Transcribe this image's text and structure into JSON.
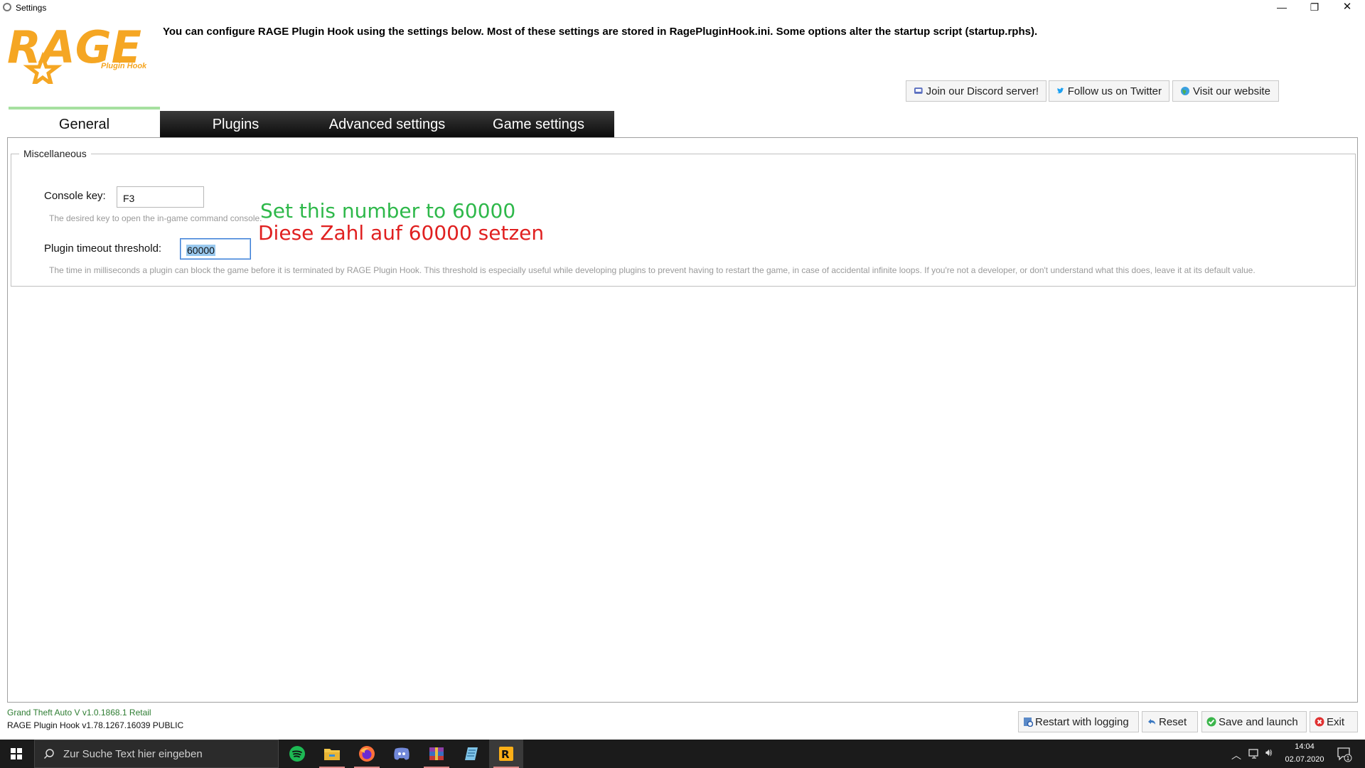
{
  "window": {
    "title": "Settings",
    "controls": {
      "minimize": "—",
      "maximize": "❐",
      "close": "✕"
    }
  },
  "header": {
    "description": "You can configure RAGE Plugin Hook using the settings below. Most of these settings are stored in RagePluginHook.ini. Some options alter the startup script (startup.rphs).",
    "logo": {
      "main": "RAGE",
      "sub": "Plugin Hook"
    },
    "links": {
      "discord": "Join our Discord server!",
      "twitter": "Follow us on Twitter",
      "website": "Visit our website"
    }
  },
  "tabs": [
    {
      "label": "General",
      "active": true
    },
    {
      "label": "Plugins",
      "active": false
    },
    {
      "label": "Advanced settings",
      "active": false
    },
    {
      "label": "Game settings",
      "active": false
    }
  ],
  "misc": {
    "legend": "Miscellaneous",
    "console_key": {
      "label": "Console key:",
      "value": "F3",
      "hint": "The desired key to open the in-game command console."
    },
    "timeout": {
      "label": "Plugin timeout threshold:",
      "value": "60000",
      "hint": "The time in milliseconds a plugin can block the game before it is terminated by RAGE Plugin Hook. This threshold is especially useful while developing plugins to prevent having to restart the game, in case of accidental infinite loops. If you're not a developer, or don't understand what this does, leave it at its default value."
    }
  },
  "annotations": {
    "english": "Set this number to 60000",
    "german": "Diese Zahl auf 60000 setzen"
  },
  "footer": {
    "game_version": "Grand Theft Auto V v1.0.1868.1 Retail",
    "hook_version": "RAGE Plugin Hook v1.78.1267.16039 PUBLIC",
    "buttons": {
      "restart": "Restart with logging",
      "reset": "Reset",
      "save": "Save and launch",
      "exit": "Exit"
    }
  },
  "taskbar": {
    "search_placeholder": "Zur Suche Text hier eingeben",
    "apps": [
      "spotify-icon",
      "file-explorer-icon",
      "firefox-icon",
      "discord-icon",
      "winrar-icon",
      "notepad-icon",
      "rockstar-icon"
    ],
    "time": "14:04",
    "date": "02.07.2020",
    "notification_count": "1"
  },
  "colors": {
    "logo": "#f5a623",
    "tab_accent": "#a6e0a0",
    "annotation_en": "#2eb84a",
    "annotation_de": "#e02020",
    "game_version": "#2e7d32"
  }
}
